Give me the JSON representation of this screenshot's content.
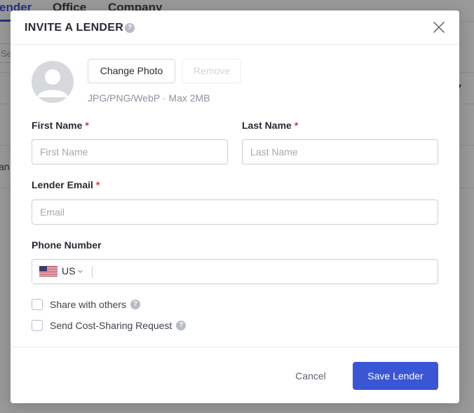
{
  "background": {
    "tabs": [
      {
        "label": "ender"
      },
      {
        "label": "Office"
      },
      {
        "label": "Company"
      }
    ],
    "search_placeholder": "Sea",
    "row_text": "an"
  },
  "modal": {
    "title": "INVITE A LENDER",
    "help_glyph": "?",
    "close_icon": "close-icon",
    "photo": {
      "change_label": "Change Photo",
      "remove_label": "Remove",
      "hint": "JPG/PNG/WebP · Max 2MB"
    },
    "first_name": {
      "label": "First Name",
      "required_mark": "*",
      "placeholder": "First Name",
      "value": ""
    },
    "last_name": {
      "label": "Last Name",
      "required_mark": "*",
      "placeholder": "Last Name",
      "value": ""
    },
    "email": {
      "label": "Lender Email",
      "required_mark": "*",
      "placeholder": "Email",
      "value": ""
    },
    "phone": {
      "label": "Phone Number",
      "country_code": "US",
      "flag_icon": "us-flag-icon",
      "value": ""
    },
    "share_others": {
      "label": "Share with others",
      "checked": false
    },
    "cost_sharing": {
      "label": "Send Cost-Sharing Request",
      "checked": false
    },
    "footer": {
      "cancel_label": "Cancel",
      "save_label": "Save Lender"
    }
  },
  "colors": {
    "primary": "#3a56d4",
    "required": "#e0363b",
    "overlay": "rgba(0,0,0,0.40)"
  }
}
